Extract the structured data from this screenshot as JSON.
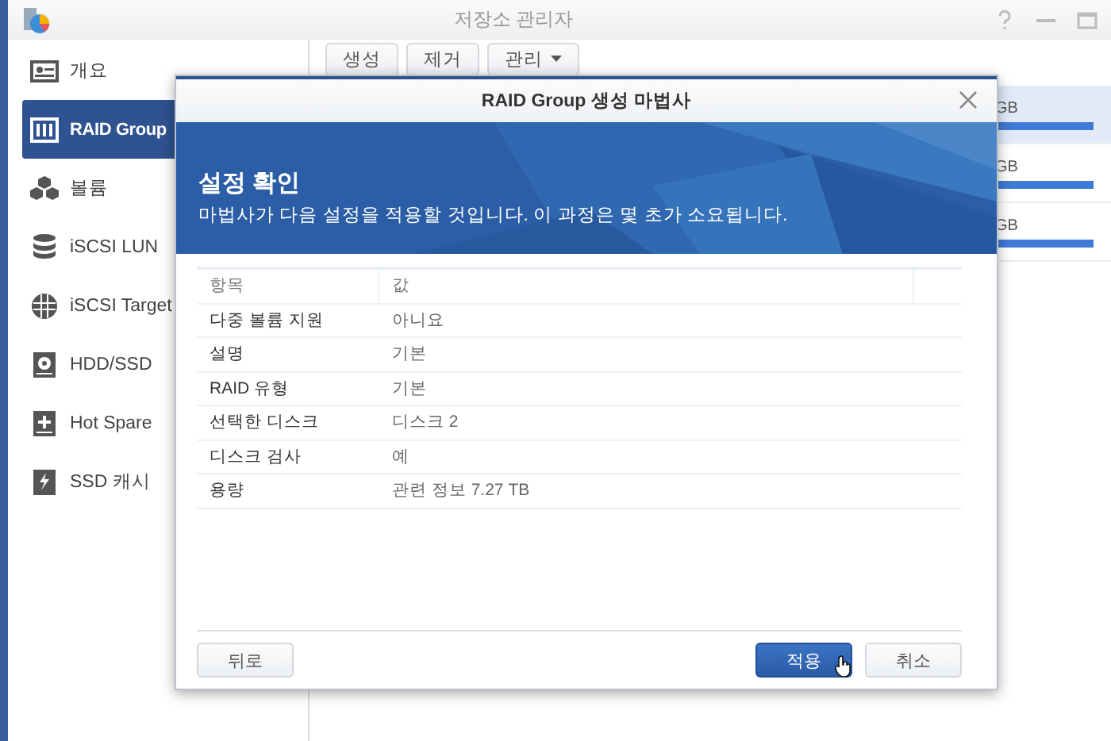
{
  "window": {
    "title": "저장소 관리자"
  },
  "sidebar": {
    "items": [
      {
        "label": "개요",
        "kind": "overview",
        "selected": false
      },
      {
        "label": "RAID Group",
        "kind": "raid",
        "selected": true
      },
      {
        "label": "볼륨",
        "kind": "volume",
        "selected": false
      },
      {
        "label": "iSCSI LUN",
        "kind": "lun",
        "selected": false
      },
      {
        "label": "iSCSI Target",
        "kind": "target",
        "selected": false
      },
      {
        "label": "HDD/SSD",
        "kind": "disk",
        "selected": false
      },
      {
        "label": "Hot Spare",
        "kind": "spare",
        "selected": false
      },
      {
        "label": "SSD 캐시",
        "kind": "cache",
        "selected": false
      }
    ]
  },
  "toolbar": {
    "buttons": [
      {
        "label": "생성",
        "dropdown": false
      },
      {
        "label": "제거",
        "dropdown": false
      },
      {
        "label": "관리",
        "dropdown": true
      }
    ]
  },
  "list": {
    "rows": [
      {
        "size": "GB",
        "selected": true
      },
      {
        "size": "GB",
        "selected": false
      },
      {
        "size": "GB",
        "selected": false
      }
    ]
  },
  "dialog": {
    "title": "RAID Group 생성 마법사",
    "heading": "설정 확인",
    "description": "마법사가 다음 설정을 적용할 것입니다. 이 과정은 몇 초가 소요됩니다.",
    "table": {
      "columns": [
        "항목",
        "값"
      ],
      "rows": [
        {
          "item": "다중 볼륨 지원",
          "value": "아니요"
        },
        {
          "item": "설명",
          "value": "기본"
        },
        {
          "item": "RAID 유형",
          "value": "기본"
        },
        {
          "item": "선택한 디스크",
          "value": "디스크 2"
        },
        {
          "item": "디스크 검사",
          "value": "예"
        },
        {
          "item": "용량",
          "value": "관련 정보 7.27 TB"
        }
      ]
    },
    "back_button": "뒤로",
    "apply_button": "적용",
    "cancel_button": "취소"
  }
}
